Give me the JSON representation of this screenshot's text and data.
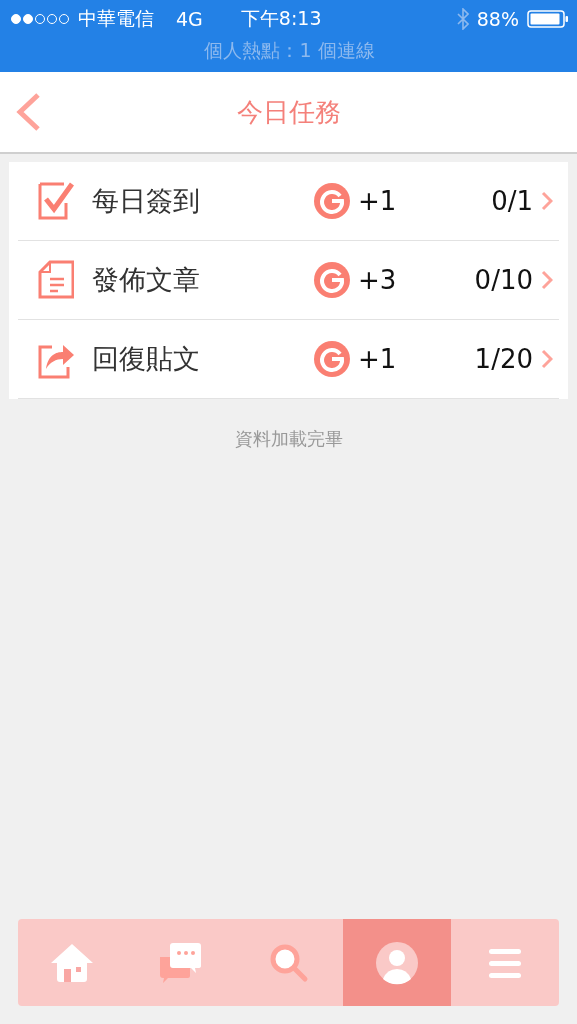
{
  "status_bar": {
    "carrier": "中華電信",
    "network": "4G",
    "time": "下午8:13",
    "battery": "88%",
    "hotspot": "個人熱點：1 個連線"
  },
  "header": {
    "title": "今日任務"
  },
  "tasks": [
    {
      "kind": "checkbox",
      "name": "每日簽到",
      "points": "+1",
      "progress": "0/1"
    },
    {
      "kind": "document",
      "name": "發佈文章",
      "points": "+3",
      "progress": "0/10"
    },
    {
      "kind": "share",
      "name": "回復貼文",
      "points": "+1",
      "progress": "1/20"
    }
  ],
  "footer_note": "資料加載完畢",
  "tab_bar": [
    {
      "kind": "home",
      "selected": false
    },
    {
      "kind": "chat",
      "selected": false
    },
    {
      "kind": "search",
      "selected": false
    },
    {
      "kind": "user",
      "selected": true
    },
    {
      "kind": "menu",
      "selected": false
    }
  ]
}
